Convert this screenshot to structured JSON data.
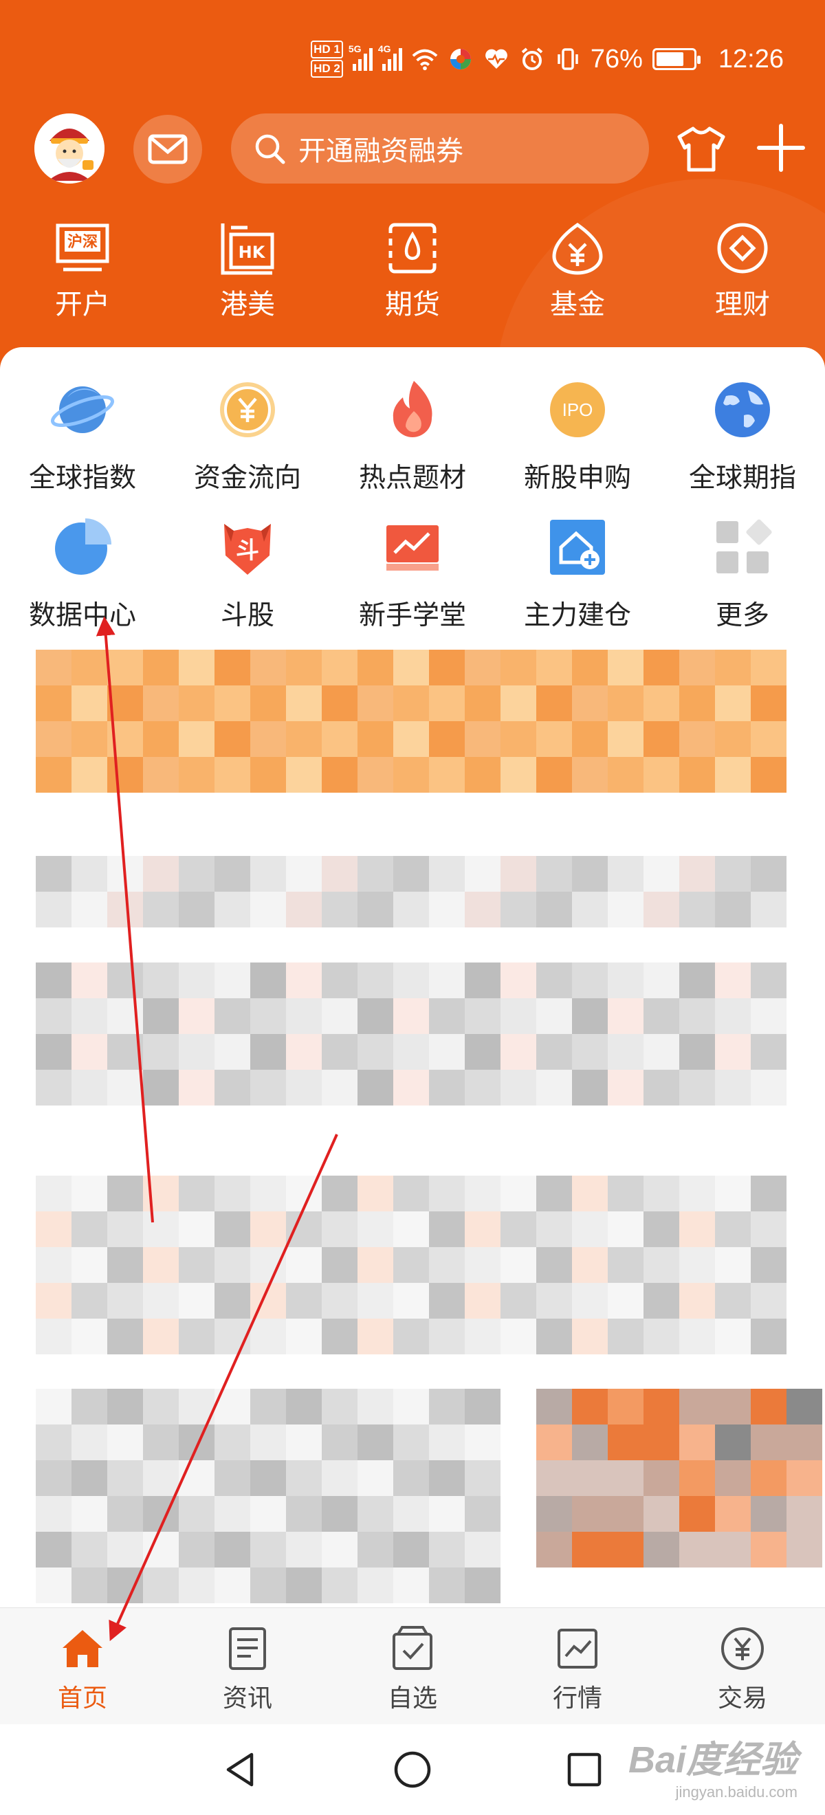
{
  "status_bar": {
    "hd1": "HD 1",
    "hd2": "HD 2",
    "signal1_gen": "5G",
    "signal2_gen": "4G",
    "wifi_gen": "6",
    "battery": "76%",
    "time": "12:26"
  },
  "header": {
    "search_placeholder": "开通融资融券",
    "quick_links": [
      {
        "label": "开户",
        "icon": "hu-shen-icon",
        "icon_text": "沪深"
      },
      {
        "label": "港美",
        "icon": "hk-icon",
        "icon_text": "HK"
      },
      {
        "label": "期货",
        "icon": "futures-icon"
      },
      {
        "label": "基金",
        "icon": "fund-icon"
      },
      {
        "label": "理财",
        "icon": "wealth-icon"
      }
    ]
  },
  "grid": {
    "row1": [
      {
        "label": "全球指数",
        "icon": "planet-icon"
      },
      {
        "label": "资金流向",
        "icon": "yuan-coin-icon"
      },
      {
        "label": "热点题材",
        "icon": "flame-icon"
      },
      {
        "label": "新股申购",
        "icon": "ipo-icon",
        "icon_text": "IPO"
      },
      {
        "label": "全球期指",
        "icon": "globe-icon"
      }
    ],
    "row2": [
      {
        "label": "数据中心",
        "icon": "pie-chart-icon"
      },
      {
        "label": "斗股",
        "icon": "dou-shield-icon",
        "icon_text": "斗"
      },
      {
        "label": "新手学堂",
        "icon": "chart-board-icon"
      },
      {
        "label": "主力建仓",
        "icon": "house-plus-icon"
      },
      {
        "label": "更多",
        "icon": "more-grid-icon"
      }
    ]
  },
  "tabbar": [
    {
      "label": "首页",
      "icon": "home-icon",
      "active": true
    },
    {
      "label": "资讯",
      "icon": "news-icon",
      "active": false
    },
    {
      "label": "自选",
      "icon": "watchlist-icon",
      "active": false
    },
    {
      "label": "行情",
      "icon": "market-chart-icon",
      "active": false
    },
    {
      "label": "交易",
      "icon": "trade-yuan-icon",
      "active": false
    }
  ],
  "watermark": {
    "brand": "Bai度经验",
    "url": "jingyan.baidu.com"
  },
  "colors": {
    "brand_orange": "#eb5b11",
    "annotation_red": "#e02020"
  }
}
